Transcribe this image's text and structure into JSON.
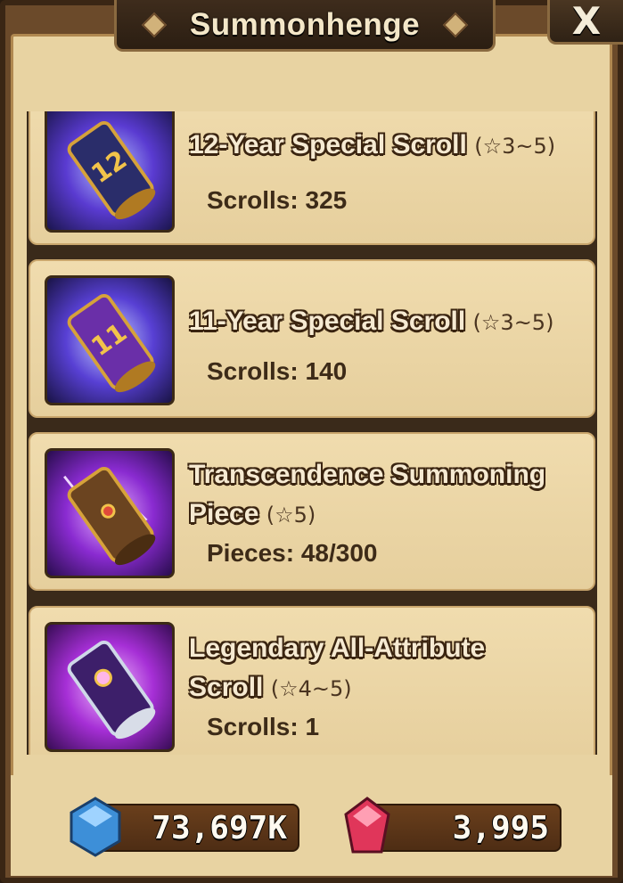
{
  "header": {
    "title": "Summonhenge",
    "close_label": "X"
  },
  "items": [
    {
      "name": "12-Year Special Scroll",
      "grade": "(☆3~5)",
      "count_label": "Scrolls",
      "count": "325",
      "icon": "scroll-12-icon"
    },
    {
      "name": "11-Year Special Scroll",
      "grade": "(☆3~5)",
      "count_label": "Scrolls",
      "count": "140",
      "icon": "scroll-11-icon"
    },
    {
      "name_line1": "Transcendence Summoning",
      "name_line2": "Piece",
      "grade": "(☆5)",
      "count_label": "Pieces",
      "count": "48/300",
      "icon": "transcendence-scroll-icon"
    },
    {
      "name_line1": "Legendary All-Attribute",
      "name_line2": "Scroll",
      "grade": "(☆4~5)",
      "count_label": "Scrolls",
      "count": "1",
      "icon": "legendary-scroll-icon"
    }
  ],
  "currency": {
    "mana": {
      "value": "73,697K",
      "icon": "mana-crystal-icon",
      "color": "#3d8fd8"
    },
    "crystal": {
      "value": "3,995",
      "icon": "crystal-gem-icon",
      "color": "#e0365a"
    }
  }
}
